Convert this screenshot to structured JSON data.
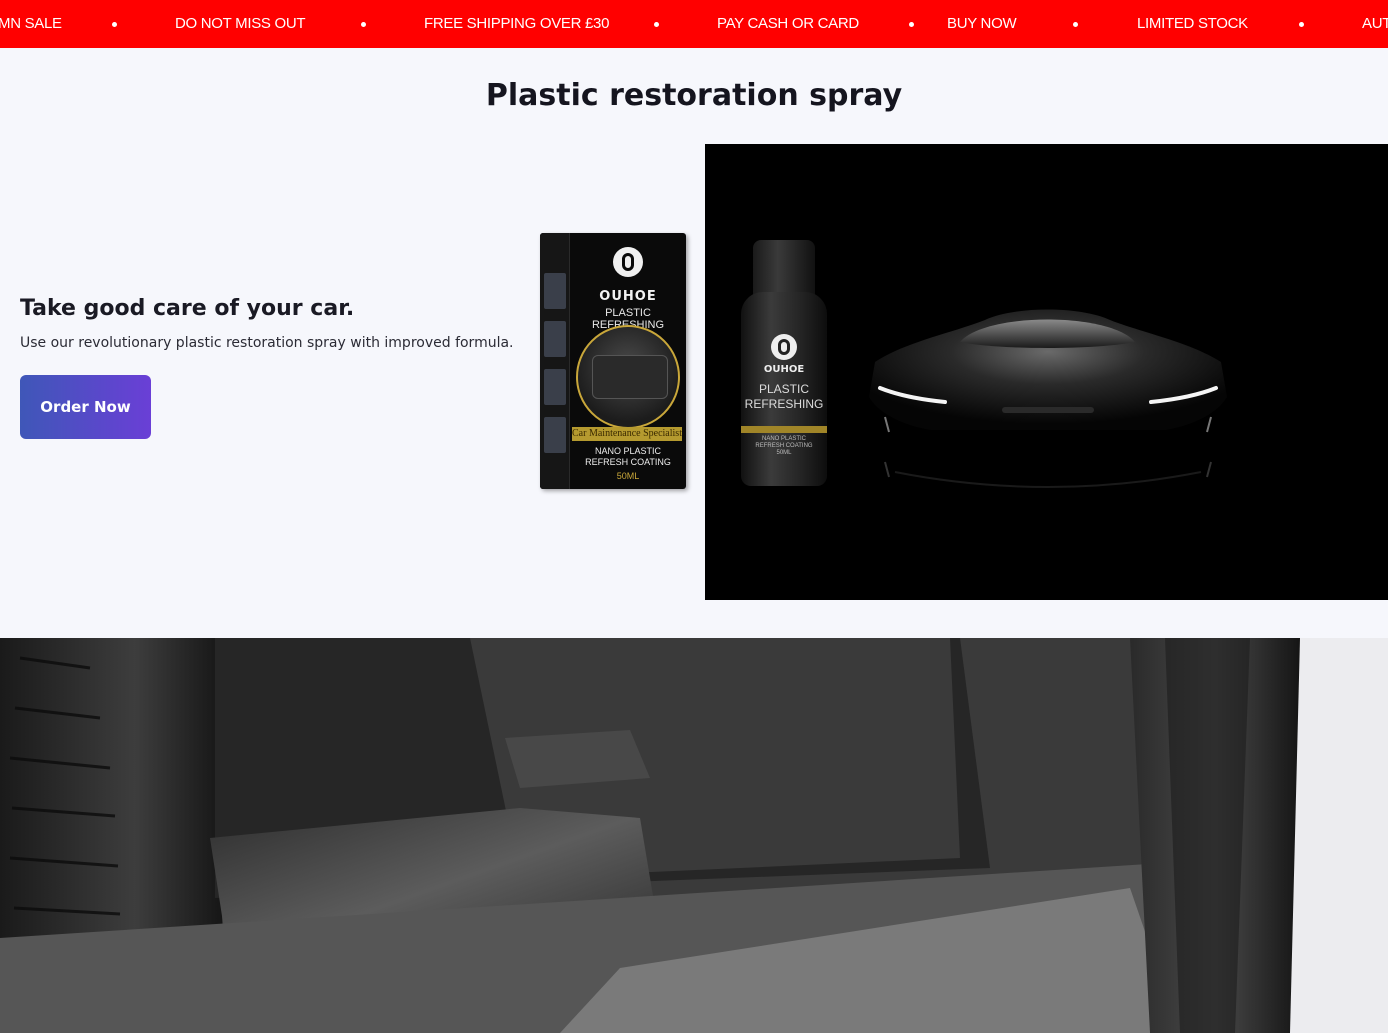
{
  "announcement_bar": {
    "items": [
      "MN SALE",
      "DO NOT MISS OUT",
      "FREE SHIPPING OVER £30",
      "PAY CASH OR CARD",
      "BUY NOW",
      "LIMITED STOCK",
      "AUT"
    ],
    "background_color": "#ff0000",
    "text_color": "#ffffff"
  },
  "page": {
    "title": "Plastic restoration spray"
  },
  "hero": {
    "heading": "Take good care of your car.",
    "subtext": "Use our revolutionary plastic restoration spray with improved formula.",
    "cta_label": "Order Now",
    "cta_gradient": [
      "#3f57b8",
      "#6a3fd6"
    ]
  },
  "product_box": {
    "brand": "OUHOE",
    "name": "PLASTIC REFRESHING",
    "banner": "Car Maintenance Specialist",
    "line1": "NANO PLASTIC",
    "line2": "REFRESH COATING",
    "size": "50ML"
  },
  "product_bottle": {
    "brand": "OUHOE",
    "name_line1": "PLASTIC",
    "name_line2": "REFRESHING",
    "small_line1": "NANO PLASTIC",
    "small_line2": "REFRESH COATING",
    "small_line3": "50ML"
  }
}
